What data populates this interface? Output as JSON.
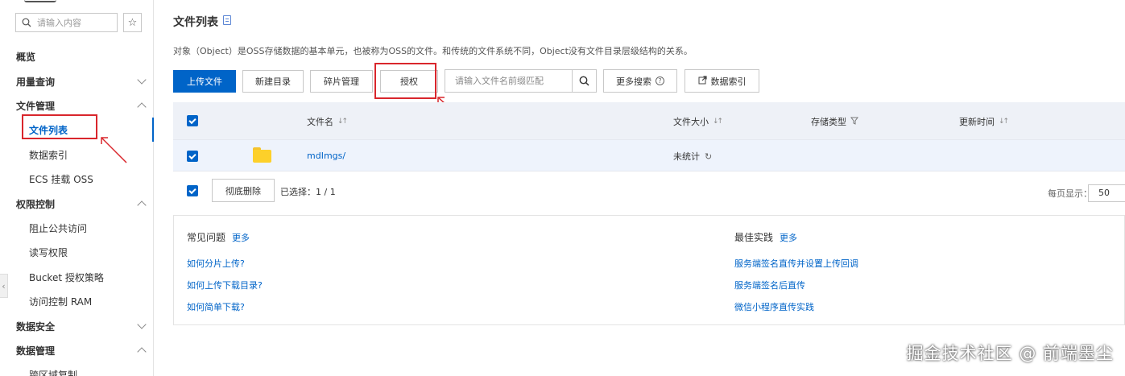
{
  "sidebar": {
    "search_placeholder": "请输入内容",
    "items": [
      {
        "label": "概览"
      },
      {
        "label": "用量查询"
      },
      {
        "label": "文件管理"
      },
      {
        "label": "文件列表"
      },
      {
        "label": "数据索引"
      },
      {
        "label": "ECS 挂载 OSS"
      },
      {
        "label": "权限控制"
      },
      {
        "label": "阻止公共访问"
      },
      {
        "label": "读写权限"
      },
      {
        "label": "Bucket 授权策略"
      },
      {
        "label": "访问控制 RAM"
      },
      {
        "label": "数据安全"
      },
      {
        "label": "数据管理"
      },
      {
        "label": "跨区域复制"
      }
    ]
  },
  "main": {
    "title": "文件列表",
    "description": "对象（Object）是OSS存储数据的基本单元，也被称为OSS的文件。和传统的文件系统不同，Object没有文件目录层级结构的关系。",
    "toolbar": {
      "upload": "上传文件",
      "new_dir": "新建目录",
      "fragments": "碎片管理",
      "authorize": "授权",
      "search_placeholder": "请输入文件名前缀匹配",
      "more_search": "更多搜索",
      "data_index": "数据索引"
    },
    "table": {
      "columns": {
        "name": "文件名",
        "size": "文件大小",
        "storage": "存储类型",
        "updated": "更新时间"
      },
      "rows": [
        {
          "name": "mdImgs/",
          "size": "未统计"
        }
      ]
    },
    "footer": {
      "delete": "彻底删除",
      "selected": "已选择：1 / 1",
      "per_page_label": "每页显示：",
      "per_page_value": "50"
    },
    "faq": {
      "common_title": "常见问题",
      "common_more": "更多",
      "common_links": [
        "如何分片上传?",
        "如何上传下载目录?",
        "如何简单下载?"
      ],
      "best_title": "最佳实践",
      "best_more": "更多",
      "best_links": [
        "服务端签名直传并设置上传回调",
        "服务端签名后直传",
        "微信小程序直传实践"
      ]
    }
  },
  "watermark": "掘金技术社区 @ 前端墨尘",
  "colors": {
    "accent": "#0064c8",
    "highlight": "#d9262c",
    "folder": "#fdd02a"
  }
}
